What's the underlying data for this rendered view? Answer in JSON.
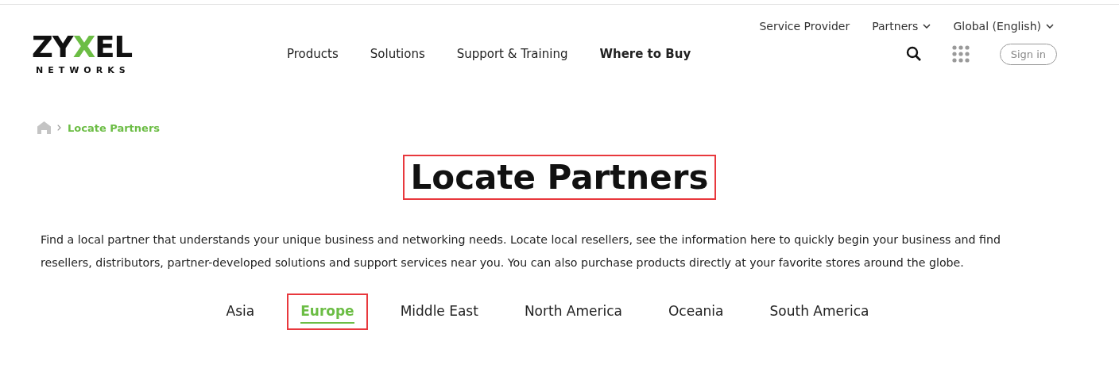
{
  "utility_nav": [
    {
      "label": "Service Provider",
      "dropdown": false
    },
    {
      "label": "Partners",
      "dropdown": true
    },
    {
      "label": "Global (English)",
      "dropdown": true
    }
  ],
  "logo": {
    "wordmark_before": "ZY",
    "wordmark_accent": "X",
    "wordmark_after": "EL",
    "tagline": "NETWORKS"
  },
  "main_nav": [
    {
      "label": "Products",
      "selected": false
    },
    {
      "label": "Solutions",
      "selected": false
    },
    {
      "label": "Support & Training",
      "selected": false
    },
    {
      "label": "Where to Buy",
      "selected": true
    }
  ],
  "sign_in": "Sign in",
  "breadcrumb": {
    "current": "Locate Partners"
  },
  "heading": {
    "text": "Locate Partners",
    "highlighted": true
  },
  "intro": "Find a local partner that understands your unique business and networking needs. Locate local resellers, see the information here to quickly begin your business and find resellers, distributors, partner-developed solutions and support services near you. You can also purchase products directly at your favorite stores around the globe.",
  "region_tabs": [
    {
      "label": "Asia",
      "selected": false,
      "highlighted": false
    },
    {
      "label": "Europe",
      "selected": true,
      "highlighted": true
    },
    {
      "label": "Middle East",
      "selected": false,
      "highlighted": false
    },
    {
      "label": "North America",
      "selected": false,
      "highlighted": false
    },
    {
      "label": "Oceania",
      "selected": false,
      "highlighted": false
    },
    {
      "label": "South America",
      "selected": false,
      "highlighted": false
    }
  ]
}
